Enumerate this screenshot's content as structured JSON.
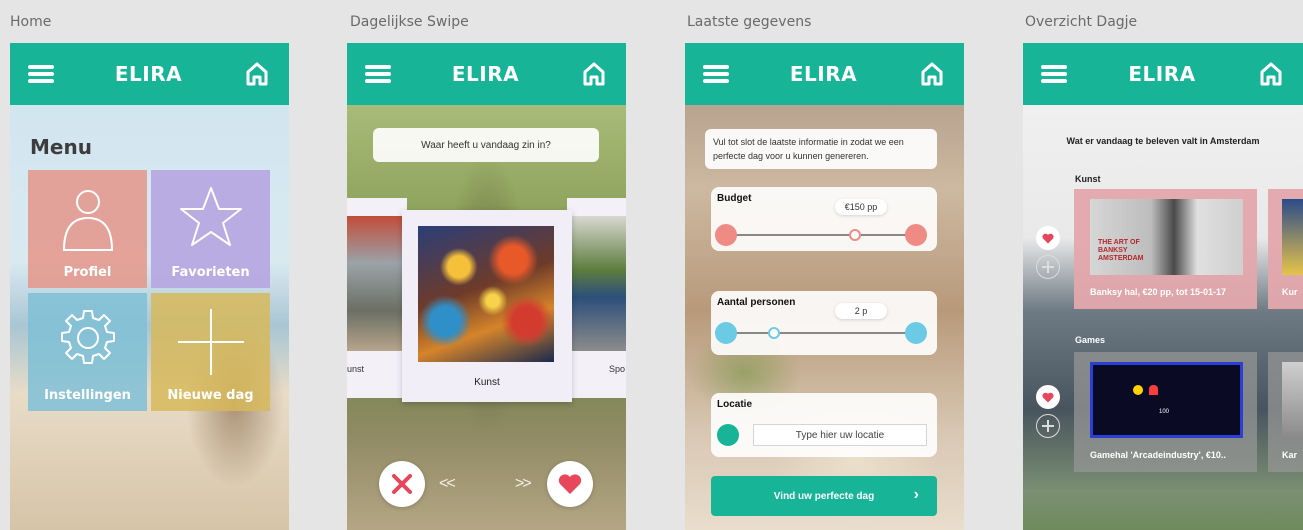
{
  "artboards": [
    {
      "title": "Home"
    },
    {
      "title": "Dagelijkse Swipe"
    },
    {
      "title": "Laatste gegevens"
    },
    {
      "title": "Overzicht Dagje"
    }
  ],
  "appbar": {
    "brand": "ELIRA",
    "menu_icon": "hamburger-icon",
    "home_icon": "home-icon"
  },
  "home": {
    "menu_title": "Menu",
    "tiles": [
      {
        "label": "Profiel",
        "icon": "user-icon",
        "color": "#e49a8f"
      },
      {
        "label": "Favorieten",
        "icon": "star-icon",
        "color": "#b5a5e0"
      },
      {
        "label": "Instellingen",
        "icon": "gear-icon",
        "color": "#7fbfd6"
      },
      {
        "label": "Nieuwe dag",
        "icon": "plus-icon",
        "color": "#d7b95a"
      }
    ]
  },
  "swipe": {
    "question": "Waar heeft u vandaag zin in?",
    "card_label": "Kunst",
    "left_peek_label": "unst",
    "right_peek_label": "Spo",
    "arrows_left": "<<",
    "arrows_right": ">>",
    "reject_color": "#e8465a",
    "like_color": "#e8465a"
  },
  "form": {
    "intro": "Vul tot slot de laatste informatie in zodat we een perfecte dag voor u kunnen genereren.",
    "budget": {
      "title": "Budget",
      "value": "€150 pp",
      "color": "#f08a84"
    },
    "persons": {
      "title": "Aantal personen",
      "value": "2 p",
      "color": "#6ccbe4"
    },
    "location": {
      "title": "Locatie",
      "placeholder": "Type hier uw locatie",
      "color": "#17b497"
    },
    "cta_label": "Vind uw perfecte dag",
    "cta_chevron": "›"
  },
  "overview": {
    "title": "Wat er vandaag te beleven valt in Amsterdam",
    "sections": [
      {
        "label": "Kunst",
        "caption": "Banksy hal, €20 pp, tot 15-01-17",
        "peek": "Kur",
        "banksy_text": "THE ART OF BANKSY AMSTERDAM"
      },
      {
        "label": "Games",
        "caption": "Gamehal 'Arcadeindustry', €10..",
        "peek": "Kar",
        "score_text": "100"
      }
    ]
  }
}
